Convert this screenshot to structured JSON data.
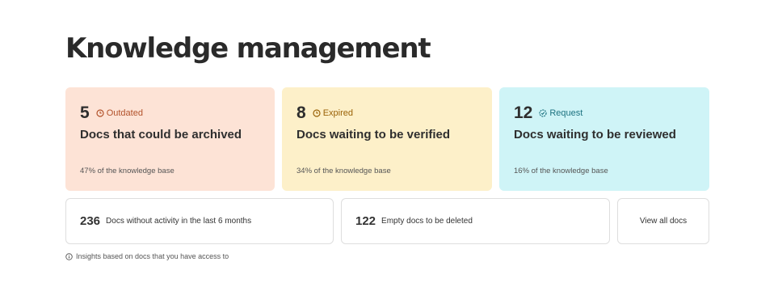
{
  "page": {
    "title": "Knowledge management"
  },
  "cards": [
    {
      "count": "5",
      "tag": "Outdated",
      "label": "Docs that could be archived",
      "share": "47% of the knowledge base",
      "icon": "clock-icon",
      "color": "#fde3d6"
    },
    {
      "count": "8",
      "tag": "Expired",
      "label": "Docs waiting to be verified",
      "share": "34% of the knowledge base",
      "icon": "clock-icon",
      "color": "#fdf0c9"
    },
    {
      "count": "12",
      "tag": "Request",
      "label": "Docs waiting to be reviewed",
      "share": "16% of the knowledge base",
      "icon": "check-badge-icon",
      "color": "#cff4f7"
    }
  ],
  "stats": [
    {
      "count": "236",
      "text": "Docs without activity in the last 6 months"
    },
    {
      "count": "122",
      "text": "Empty docs to be deleted"
    }
  ],
  "actions": {
    "view_all": "View all docs"
  },
  "footnote": {
    "icon": "info-icon",
    "text": "Insights based on docs that you have access to"
  }
}
